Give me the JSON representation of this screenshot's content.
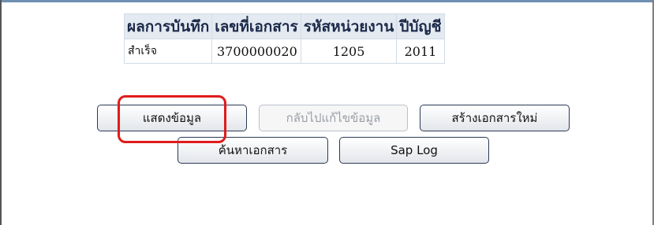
{
  "result_table": {
    "headers": [
      "ผลการบันทึก",
      "เลขที่เอกสาร",
      "รหัสหน่วยงาน",
      "ปีบัญชี"
    ],
    "row": {
      "status": "สำเร็จ",
      "document_no": "3700000020",
      "unit_code": "1205",
      "fiscal_year": "2011"
    }
  },
  "buttons": {
    "show_data": "แสดงข้อมูล",
    "back_to_edit": "กลับไปแก้ไขข้อมูล",
    "create_new_document": "สร้างเอกสารใหม่",
    "search_document": "ค้นหาเอกสาร",
    "sap_log": "Sap Log"
  },
  "highlight_color": "#e01b1b"
}
